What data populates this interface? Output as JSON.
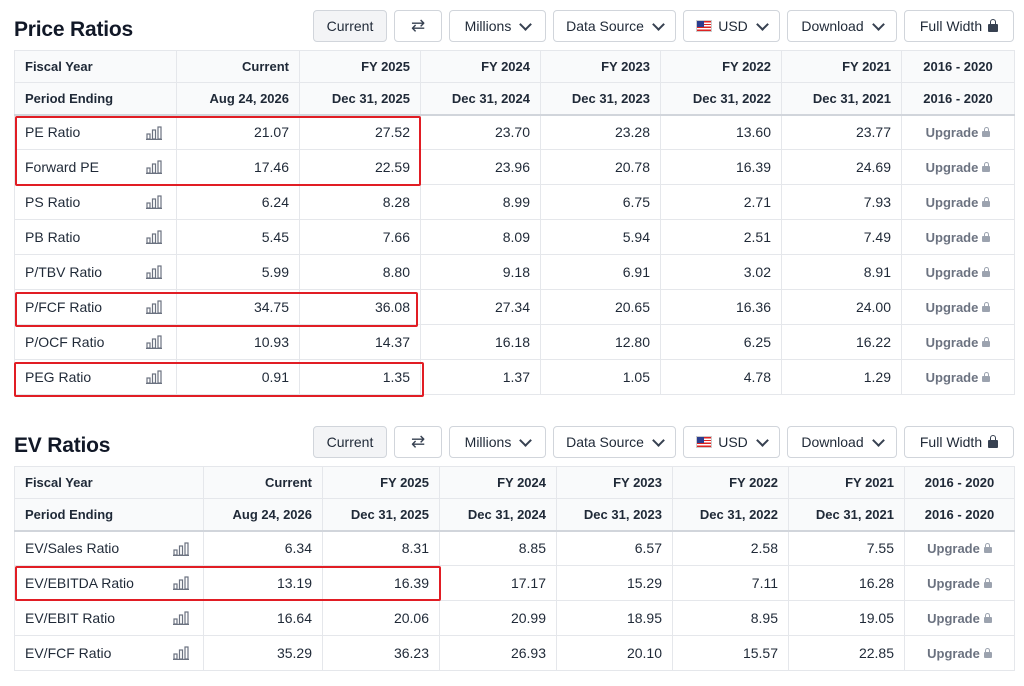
{
  "toolbar": {
    "current": "Current",
    "millions": "Millions",
    "data_source": "Data Source",
    "currency": "USD",
    "download": "Download",
    "full_width": "Full Width"
  },
  "price": {
    "title": "Price Ratios",
    "head_row1": [
      "Fiscal Year",
      "Current",
      "FY 2025",
      "FY 2024",
      "FY 2023",
      "FY 2022",
      "FY 2021",
      "2016 - 2020"
    ],
    "head_row2": [
      "Period Ending",
      "Aug 24, 2026",
      "Dec 31, 2025",
      "Dec 31, 2024",
      "Dec 31, 2023",
      "Dec 31, 2022",
      "Dec 31, 2021",
      "2016 - 2020"
    ],
    "rows": [
      {
        "label": "PE Ratio",
        "values": [
          "21.07",
          "27.52",
          "23.70",
          "23.28",
          "13.60",
          "23.77"
        ]
      },
      {
        "label": "Forward PE",
        "values": [
          "17.46",
          "22.59",
          "23.96",
          "20.78",
          "16.39",
          "24.69"
        ]
      },
      {
        "label": "PS Ratio",
        "values": [
          "6.24",
          "8.28",
          "8.99",
          "6.75",
          "2.71",
          "7.93"
        ]
      },
      {
        "label": "PB Ratio",
        "values": [
          "5.45",
          "7.66",
          "8.09",
          "5.94",
          "2.51",
          "7.49"
        ]
      },
      {
        "label": "P/TBV Ratio",
        "values": [
          "5.99",
          "8.80",
          "9.18",
          "6.91",
          "3.02",
          "8.91"
        ]
      },
      {
        "label": "P/FCF Ratio",
        "values": [
          "34.75",
          "36.08",
          "27.34",
          "20.65",
          "16.36",
          "24.00"
        ]
      },
      {
        "label": "P/OCF Ratio",
        "values": [
          "10.93",
          "14.37",
          "16.18",
          "12.80",
          "6.25",
          "16.22"
        ]
      },
      {
        "label": "PEG Ratio",
        "values": [
          "0.91",
          "1.35",
          "1.37",
          "1.05",
          "4.78",
          "1.29"
        ]
      }
    ],
    "upgrade": "Upgrade"
  },
  "ev": {
    "title": "EV Ratios",
    "head_row1": [
      "Fiscal Year",
      "Current",
      "FY 2025",
      "FY 2024",
      "FY 2023",
      "FY 2022",
      "FY 2021",
      "2016 - 2020"
    ],
    "head_row2": [
      "Period Ending",
      "Aug 24, 2026",
      "Dec 31, 2025",
      "Dec 31, 2024",
      "Dec 31, 2023",
      "Dec 31, 2022",
      "Dec 31, 2021",
      "2016 - 2020"
    ],
    "rows": [
      {
        "label": "EV/Sales Ratio",
        "values": [
          "6.34",
          "8.31",
          "8.85",
          "6.57",
          "2.58",
          "7.55"
        ]
      },
      {
        "label": "EV/EBITDA Ratio",
        "values": [
          "13.19",
          "16.39",
          "17.17",
          "15.29",
          "7.11",
          "16.28"
        ]
      },
      {
        "label": "EV/EBIT Ratio",
        "values": [
          "16.64",
          "20.06",
          "20.99",
          "18.95",
          "8.95",
          "19.05"
        ]
      },
      {
        "label": "EV/FCF Ratio",
        "values": [
          "35.29",
          "36.23",
          "26.93",
          "20.10",
          "15.57",
          "22.85"
        ]
      }
    ],
    "upgrade": "Upgrade"
  },
  "colors": {
    "highlight": "#e11d24",
    "header_bg": "#f9fafb",
    "border": "#e5e7eb"
  }
}
